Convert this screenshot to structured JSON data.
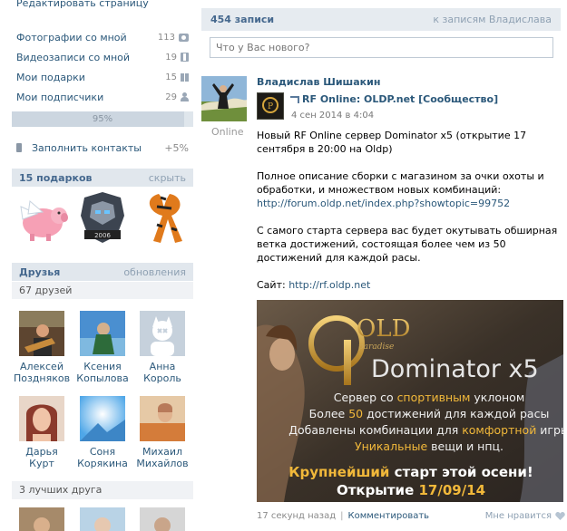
{
  "colors": {
    "link": "#2b587a",
    "header_bg": "#e1e7ed",
    "title": "#45688e",
    "muted": "#8fa1b3"
  },
  "left": {
    "edit_page": "Редактировать страницу",
    "media": [
      {
        "label": "Фотографии со мной",
        "count": "113",
        "icon": "camera-icon"
      },
      {
        "label": "Видеозаписи со мной",
        "count": "19",
        "icon": "film-icon"
      },
      {
        "label": "Мои подарки",
        "count": "15",
        "icon": "gift-icon"
      },
      {
        "label": "Мои подписчики",
        "count": "29",
        "icon": "person-icon"
      }
    ],
    "progress": {
      "label": "95%",
      "value": 0.95
    },
    "fill_contacts": {
      "label": "Заполнить контакты",
      "bonus": "+5%"
    },
    "gifts": {
      "title": "15 подарков",
      "hide": "скрыть"
    },
    "friends": {
      "title": "Друзья",
      "updates": "обновления",
      "count": "67 друзей",
      "items": [
        {
          "first": "Алексей",
          "last": "Поздняков"
        },
        {
          "first": "Ксения",
          "last": "Копылова"
        },
        {
          "first": "Анна",
          "last": "Король"
        },
        {
          "first": "Дарья",
          "last": "Курт"
        },
        {
          "first": "Соня",
          "last": "Корякина"
        },
        {
          "first": "Михаил",
          "last": "Михайлов"
        }
      ],
      "best": "3 лучших друга"
    }
  },
  "wall": {
    "count": "454 записи",
    "to_posts": "к записям Владислава",
    "placeholder": "Что у Вас нового?",
    "post": {
      "author": "Владислав Шишакин",
      "online": "Online",
      "group": "RF Online: OLDP.net [Сообщество]",
      "date": "4 сен 2014 в 4:04",
      "p1": "Новый RF Online сервер Dominator x5 (открытие 17 сентября в 20:00 на Oldp)",
      "p2a": "Полное описание сборки с магазином за очки охоты и обработки, и множеством новых комбинаций:",
      "p2_link": "http://forum.oldp.net/index.php?showtopic=99752",
      "p3": "С самого старта сервера вас будет окутывать обширная ветка достижений, состоящая более чем из 50 достижений для каждой расы.",
      "site_label": "Сайт: ",
      "site_link": "http://rf.oldp.net",
      "banner": {
        "logo": "OLD",
        "logo_sub": "paradise",
        "title": "Dominator x5",
        "l1a": "Сервер со ",
        "l1b": "спортивным",
        "l1c": " уклоном",
        "l2a": "Более ",
        "l2b": "50",
        "l2c": " достижений для каждой расы",
        "l3a": "Добавлены комбинации для ",
        "l3b": "комфортной",
        "l3c": " игры",
        "l4a": "Уникальные",
        "l4b": " вещи и нпц.",
        "l5a": "Крупнейший",
        "l5b": " старт этой осени!",
        "l6a": "Открытие ",
        "l6b": "17/09/14"
      },
      "time_ago": "17 секунд назад",
      "comment": "Комментировать",
      "like": "Мне нравится"
    }
  }
}
